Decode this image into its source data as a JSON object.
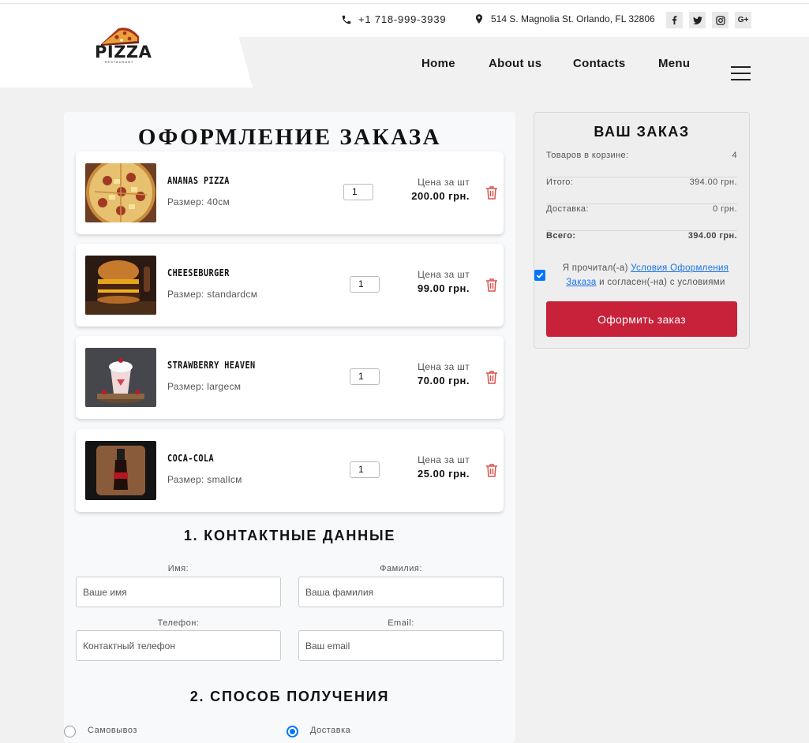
{
  "header": {
    "logo_text": "PIZZA",
    "logo_subtext": "RESTAURANT",
    "phone": "+1 718-999-3939",
    "address": "514 S. Magnolia St. Orlando, FL 32806",
    "socials": [
      {
        "icon": "facebook-icon",
        "glyph": "f"
      },
      {
        "icon": "twitter-icon",
        "glyph": "t"
      },
      {
        "icon": "instagram-icon",
        "glyph": "ig"
      },
      {
        "icon": "google-plus-icon",
        "glyph": "G+"
      }
    ],
    "nav": [
      "Home",
      "About us",
      "Contacts",
      "Menu"
    ]
  },
  "page_title": "ОФОРМЛЕНИЕ ЗАКАЗА",
  "cart": {
    "price_label": "Цена за шт",
    "items": [
      {
        "name": "ANANAS PIZZA",
        "size": "Размер: 40см",
        "qty": "1",
        "price": "200.00 грн."
      },
      {
        "name": "CHEESEBURGER",
        "size": "Размер: standardсм",
        "qty": "1",
        "price": "99.00 грн."
      },
      {
        "name": "STRAWBERRY HEAVEN",
        "size": "Размер: largeсм",
        "qty": "1",
        "price": "70.00 грн."
      },
      {
        "name": "COCA-COLA",
        "size": "Размер: smallсм",
        "qty": "1",
        "price": "25.00 грн."
      }
    ]
  },
  "contacts": {
    "title": "1. КОНТАКТНЫЕ ДАННЫЕ",
    "first_name_label": "Имя:",
    "first_name_placeholder": "Ваше имя",
    "last_name_label": "Фамилия:",
    "last_name_placeholder": "Ваша фамилия",
    "phone_label": "Телефон:",
    "phone_placeholder": "Контактный телефон",
    "email_label": "Email:",
    "email_placeholder": "Ваш email"
  },
  "delivery": {
    "title": "2. СПОСОБ ПОЛУЧЕНИЯ",
    "options": [
      "Самовывоз",
      "Доставка"
    ],
    "selected": "Доставка"
  },
  "summary": {
    "title": "ВАШ ЗАКАЗ",
    "rows": [
      {
        "label": "Товаров в корзине:",
        "value": "4"
      },
      {
        "label": "Итого:",
        "value": "394.00 грн."
      },
      {
        "label": "Доставка:",
        "value": "0 грн."
      },
      {
        "label": "Всего:",
        "value": "394.00 грн."
      }
    ],
    "agree_prefix": "Я прочитал(-а)",
    "agree_link": "Условия Оформления Заказа",
    "agree_suffix": "и согласен(-на) с условиями",
    "agree_checked": true,
    "submit_label": "Оформить заказ"
  },
  "colors": {
    "accent": "#c8213a",
    "checkbox": "#0075ff",
    "link": "#1a73e8"
  }
}
